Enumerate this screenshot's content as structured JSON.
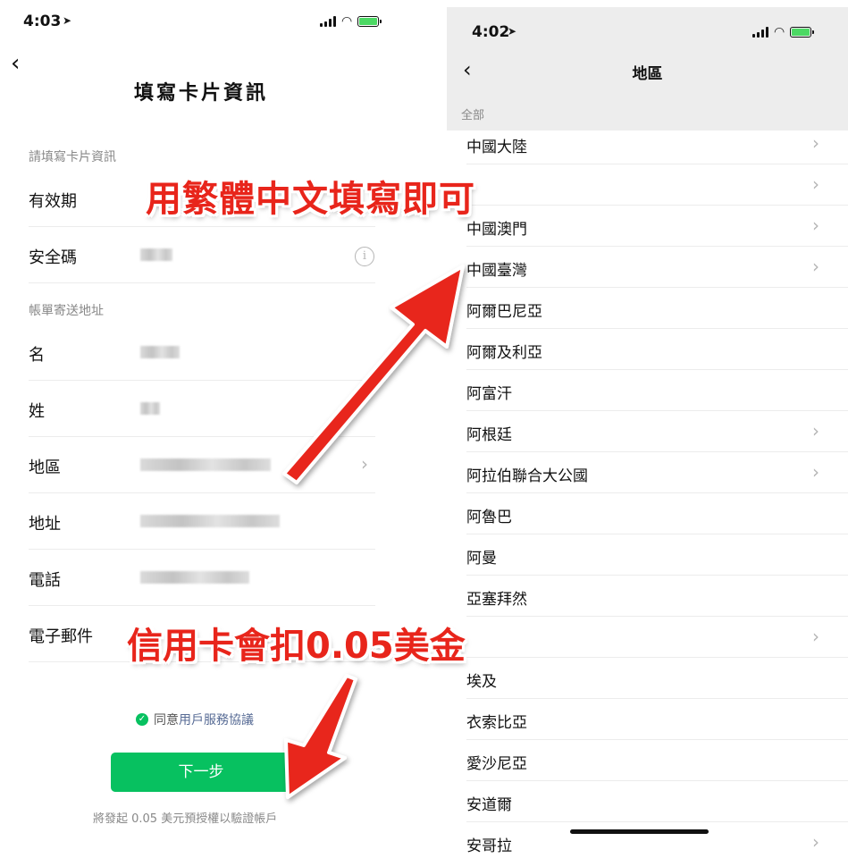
{
  "left": {
    "status_time": "4:03",
    "title": "填寫卡片資訊",
    "section_card": "請填寫卡片資訊",
    "section_address": "帳單寄送地址",
    "fields": {
      "expiry": "有效期",
      "cvv": "安全碼",
      "first_name": "名",
      "last_name": "姓",
      "region": "地區",
      "address": "地址",
      "phone": "電話",
      "email": "電子郵件"
    },
    "agree_prefix": "同意",
    "agree_link": "用戶服務協議",
    "next_button": "下一步",
    "footnote": "將發起 0.05 美元預授權以驗證帳戶"
  },
  "right": {
    "status_time": "4:02",
    "title": "地區",
    "group_label": "全部",
    "regions": [
      {
        "name": "中國大陸",
        "has_arrow": true
      },
      {
        "name": "",
        "has_arrow": true
      },
      {
        "name": "中國澳門",
        "has_arrow": true
      },
      {
        "name": "中國臺灣",
        "has_arrow": true
      },
      {
        "name": "阿爾巴尼亞",
        "has_arrow": false
      },
      {
        "name": "阿爾及利亞",
        "has_arrow": false
      },
      {
        "name": "阿富汗",
        "has_arrow": false
      },
      {
        "name": "阿根廷",
        "has_arrow": true
      },
      {
        "name": "阿拉伯聯合大公國",
        "has_arrow": true
      },
      {
        "name": "阿魯巴",
        "has_arrow": false
      },
      {
        "name": "阿曼",
        "has_arrow": false
      },
      {
        "name": "亞塞拜然",
        "has_arrow": false
      },
      {
        "name": "",
        "has_arrow": true
      },
      {
        "name": "埃及",
        "has_arrow": false
      },
      {
        "name": "衣索比亞",
        "has_arrow": false
      },
      {
        "name": "愛沙尼亞",
        "has_arrow": false
      },
      {
        "name": "安道爾",
        "has_arrow": false
      },
      {
        "name": "安哥拉",
        "has_arrow": true
      }
    ]
  },
  "annotations": {
    "top": "用繁體中文填寫即可",
    "bottom": "信用卡會扣0.05美金"
  },
  "colors": {
    "accent_green": "#07c160",
    "link_blue": "#576b95",
    "annotation_red": "#e8251b"
  }
}
